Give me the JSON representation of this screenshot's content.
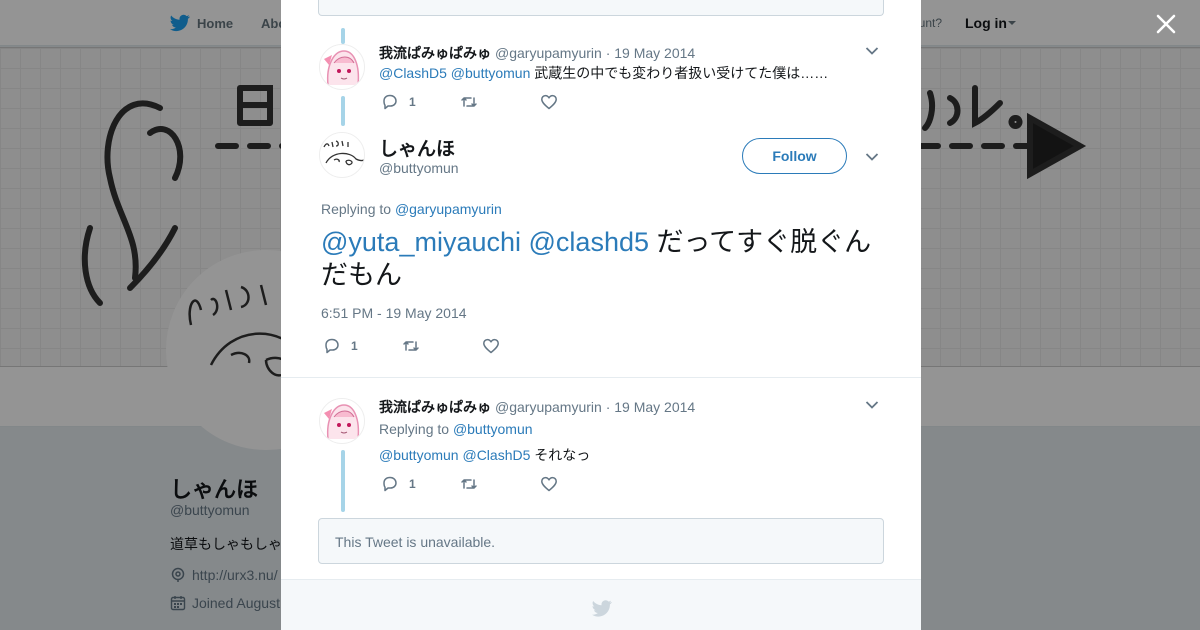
{
  "nav": {
    "home_label": "Home",
    "about_label": "Abo",
    "account_text": "ccount?",
    "login_label": "Log in"
  },
  "profile": {
    "name": "しゃんほ",
    "handle": "@buttyomun",
    "bio": "道草もしゃもしゃ",
    "link": "http://urx3.nu/",
    "joined": "Joined August"
  },
  "thread": {
    "tweet1": {
      "name": "我流ぱみゅぱみゅ",
      "handle": "@garyupamyurin",
      "date": "· 19 May 2014",
      "mention1": "@ClashD5",
      "mention2": "@buttyomun",
      "text": "武蔵生の中でも変わり者扱い受けてた僕は……",
      "reply_count": "1"
    },
    "main": {
      "name": "しゃんほ",
      "handle": "@buttyomun",
      "follow_label": "Follow",
      "replying_prefix": "Replying to",
      "replying_mention": "@garyupamyurin",
      "mention1": "@yuta_miyauchi",
      "mention2": "@clashd5",
      "text": "だってすぐ脱ぐんだもん",
      "timestamp": "6:51 PM - 19 May 2014",
      "reply_count": "1"
    },
    "tweet3": {
      "name": "我流ぱみゅぱみゅ",
      "handle": "@garyupamyurin",
      "date": "· 19 May 2014",
      "replying_prefix": "Replying to",
      "replying_mention": "@buttyomun",
      "mention1": "@buttyomun",
      "mention2": "@ClashD5",
      "text": "それなっ",
      "reply_count": "1"
    },
    "unavailable_text": "This Tweet is unavailable."
  },
  "colors": {
    "link": "#2b7bb9",
    "thread_line": "#a6d4e8",
    "muted": "#657786"
  },
  "icons": [
    "twitter-bird-icon",
    "close-icon",
    "chevron-down-icon",
    "reply-icon",
    "retweet-icon",
    "like-icon",
    "link-icon",
    "calendar-icon"
  ]
}
